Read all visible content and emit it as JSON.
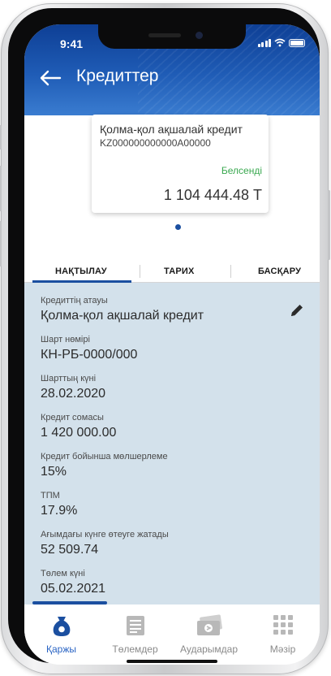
{
  "status_bar": {
    "time": "9:41"
  },
  "header": {
    "title": "Кредиттер"
  },
  "loan_card": {
    "name": "Қолма-қол ақшалай кредит",
    "account": "KZ000000000000A00000",
    "status": "Белсенді",
    "amount": "1 104 444.48 Т"
  },
  "tabs": [
    {
      "label": "НАҚТЫЛАУ",
      "active": true
    },
    {
      "label": "ТАРИХ",
      "active": false
    },
    {
      "label": "БАСҚАРУ",
      "active": false
    }
  ],
  "details": [
    {
      "label": "Кредиттің атауы",
      "value": "Қолма-қол ақшалай кредит"
    },
    {
      "label": "Шарт нөмірі",
      "value": "КН-РБ-0000/000"
    },
    {
      "label": "Шарттың күні",
      "value": "28.02.2020"
    },
    {
      "label": "Кредит сомасы",
      "value": "1 420 000.00"
    },
    {
      "label": "Кредит бойынша мөлшерлеме",
      "value": "15%"
    },
    {
      "label": "ТПМ",
      "value": "17.9%"
    },
    {
      "label": "Ағымдағы күнге өтеуге жатады",
      "value": "52 509.74"
    },
    {
      "label": "Төлем күні",
      "value": "05.02.2021"
    }
  ],
  "bottom_nav": [
    {
      "label": "Қаржы",
      "icon": "money-bag-icon",
      "active": true
    },
    {
      "label": "Төлемдер",
      "icon": "payments-icon",
      "active": false
    },
    {
      "label": "Аударымдар",
      "icon": "transfer-icon",
      "active": false
    },
    {
      "label": "Мәзір",
      "icon": "menu-grid-icon",
      "active": false
    }
  ],
  "colors": {
    "brand_blue": "#1b4fa0",
    "active_status": "#39a84f",
    "details_background": "#d3e1eb"
  }
}
